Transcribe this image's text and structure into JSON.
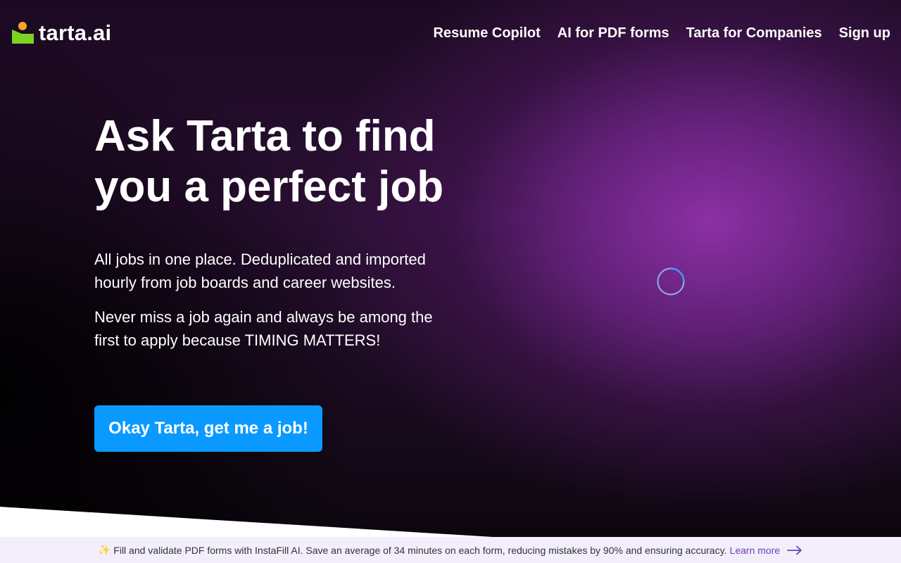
{
  "brand": {
    "name": "tarta.ai",
    "colors": {
      "dot": "#f5a623",
      "block": "#7ed321"
    }
  },
  "nav": {
    "items": [
      {
        "label": "Resume Copilot"
      },
      {
        "label": "AI for PDF forms"
      },
      {
        "label": "Tarta for Companies"
      },
      {
        "label": "Sign up"
      }
    ]
  },
  "hero": {
    "title_line1": "Ask Tarta to find",
    "title_line2": "you a perfect job",
    "paragraph1": "All jobs in one place. Deduplicated and imported hourly from job boards and career websites.",
    "paragraph2": "Never miss a job again and always be among the first to apply because TIMING MATTERS!",
    "cta_label": "Okay Tarta, get me a job!",
    "cta_color": "#0a99ff"
  },
  "banner": {
    "spark": "✨",
    "text": "Fill and validate PDF forms with InstaFill AI. Save an average of 34 minutes on each form, reducing mistakes by 90% and ensuring accuracy.",
    "link_label": "Learn more",
    "arrow_icon": "arrow-right-icon"
  },
  "loading": {
    "icon": "loading-spinner-icon"
  }
}
